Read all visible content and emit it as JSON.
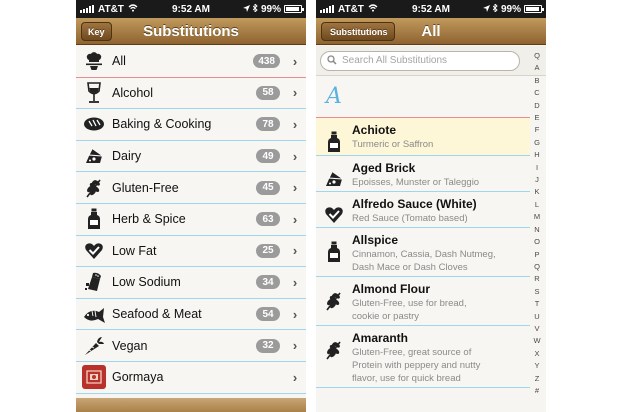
{
  "status": {
    "carrier": "AT&T",
    "time": "9:52 AM",
    "battery": "99%"
  },
  "left": {
    "nav": {
      "button_label": "Key",
      "title": "Substitutions"
    },
    "categories": [
      {
        "label": "All",
        "count": "438",
        "icon": "chef-icon"
      },
      {
        "label": "Alcohol",
        "count": "58",
        "icon": "wine-glass-icon"
      },
      {
        "label": "Baking & Cooking",
        "count": "78",
        "icon": "bread-icon"
      },
      {
        "label": "Dairy",
        "count": "49",
        "icon": "cheese-icon"
      },
      {
        "label": "Gluten-Free",
        "count": "45",
        "icon": "wheat-icon"
      },
      {
        "label": "Herb & Spice",
        "count": "63",
        "icon": "spice-bottle-icon"
      },
      {
        "label": "Low Fat",
        "count": "25",
        "icon": "heart-check-icon"
      },
      {
        "label": "Low Sodium",
        "count": "34",
        "icon": "salt-shaker-icon"
      },
      {
        "label": "Seafood & Meat",
        "count": "54",
        "icon": "fish-icon"
      },
      {
        "label": "Vegan",
        "count": "32",
        "icon": "carrot-icon"
      },
      {
        "label": "Gormaya",
        "count": "",
        "icon": "gormaya-logo-icon"
      }
    ]
  },
  "right": {
    "nav": {
      "back_label": "Substitutions",
      "title": "All"
    },
    "search": {
      "placeholder": "Search All Substitutions"
    },
    "section_letter": "A",
    "index_letters": [
      "Q",
      "A",
      "B",
      "C",
      "D",
      "E",
      "F",
      "G",
      "H",
      "I",
      "J",
      "K",
      "L",
      "M",
      "N",
      "O",
      "P",
      "Q",
      "R",
      "S",
      "T",
      "U",
      "V",
      "W",
      "X",
      "Y",
      "Z",
      "#"
    ],
    "items": [
      {
        "name": "Achiote",
        "detail": [
          "Turmeric or Saffron"
        ],
        "icon": "spice-bottle-icon",
        "selected": true
      },
      {
        "name": "Aged Brick",
        "detail": [
          "Epoisses, Munster or Taleggio"
        ],
        "icon": "cheese-icon",
        "selected": false
      },
      {
        "name": "Alfredo Sauce (White)",
        "detail": [
          "Red Sauce (Tomato based)"
        ],
        "icon": "heart-check-icon",
        "selected": false
      },
      {
        "name": "Allspice",
        "detail": [
          "Cinnamon, Cassia, Dash Nutmeg,",
          "Dash Mace or Dash Cloves"
        ],
        "icon": "spice-bottle-icon",
        "selected": false
      },
      {
        "name": "Almond Flour",
        "detail": [
          "Gluten-Free, use for bread,",
          "cookie or pastry"
        ],
        "icon": "wheat-icon",
        "selected": false
      },
      {
        "name": "Amaranth",
        "detail": [
          "Gluten-Free, great source of",
          "Protein with peppery and nutty",
          "flavor, use for quick bread"
        ],
        "icon": "wheat-icon",
        "selected": false
      }
    ]
  },
  "colors": {
    "nav_top": "#c19a5d",
    "nav_bottom": "#8e6330",
    "divider_blue": "#9ed6ee",
    "divider_red": "#e88d8d",
    "section_letter": "#58b3de",
    "badge": "#9b9b9b"
  }
}
